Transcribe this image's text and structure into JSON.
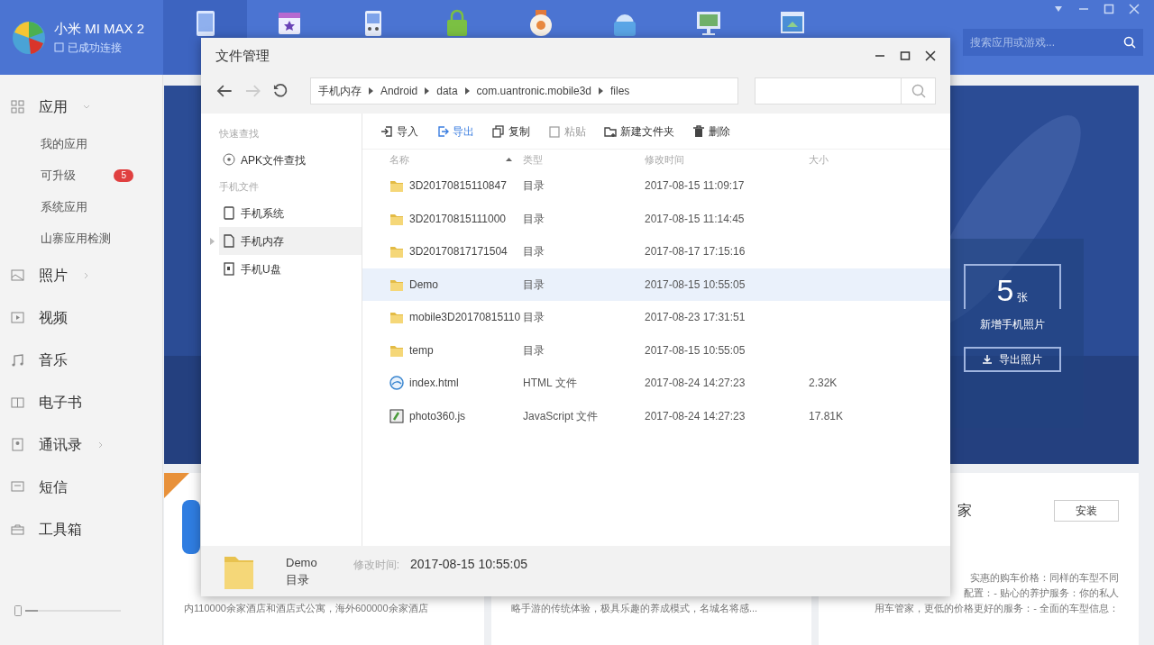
{
  "app": {
    "device_name": "小米 MI MAX 2",
    "connection_status": "已成功连接",
    "search_placeholder": "搜索应用或游戏..."
  },
  "top_nav": [
    {
      "kind": "tablet",
      "selected": true
    },
    {
      "kind": "calendar",
      "selected": false
    },
    {
      "kind": "gamepad",
      "selected": false
    },
    {
      "kind": "bag",
      "selected": false
    },
    {
      "kind": "medal",
      "selected": false
    },
    {
      "kind": "basket",
      "selected": false
    },
    {
      "kind": "monitor",
      "selected": false
    },
    {
      "kind": "window",
      "selected": false
    }
  ],
  "sidebar": {
    "items": [
      {
        "label": "应用",
        "kind": "apps",
        "expanded": true,
        "children": [
          {
            "label": "我的应用"
          },
          {
            "label": "可升级",
            "badge": "5"
          },
          {
            "label": "系统应用"
          },
          {
            "label": "山寨应用检测"
          }
        ]
      },
      {
        "label": "照片",
        "expanded": false
      },
      {
        "label": "视频",
        "kind": "video"
      },
      {
        "label": "音乐",
        "kind": "music"
      },
      {
        "label": "电子书",
        "kind": "book"
      },
      {
        "label": "通讯录",
        "kind": "contacts",
        "expanded": false
      },
      {
        "label": "短信",
        "kind": "sms"
      },
      {
        "label": "工具箱",
        "kind": "toolbox"
      }
    ]
  },
  "photo_panel": {
    "count": "5",
    "unit": "张",
    "label": "新增手机照片",
    "button": "导出照片"
  },
  "cards": [
    {
      "lines": [
        "内110000余家酒店和酒店式公寓，海外600000余家酒店"
      ]
    },
    {
      "lines": [
        "略手游的传统体验，极具乐趣的养成模式，名城名将感..."
      ]
    },
    {
      "title": "家",
      "button": "安装",
      "lines": [
        "实惠的购车价格：同样的车型不同",
        "配置：- 贴心的养护服务：你的私人",
        "用车管家，更低的价格更好的服务：- 全面的车型信息："
      ]
    }
  ],
  "dialog": {
    "title": "文件管理",
    "breadcrumb": [
      "手机内存",
      "Android",
      "data",
      "com.uantronic.mobile3d",
      "files"
    ],
    "sections": [
      {
        "heading": "快速查找",
        "items": [
          {
            "kind": "target",
            "label": "APK文件查找",
            "selected": false
          }
        ]
      },
      {
        "heading": "手机文件",
        "items": [
          {
            "kind": "phone",
            "label": "手机系统",
            "selected": false
          },
          {
            "kind": "card",
            "label": "手机内存",
            "selected": true
          },
          {
            "kind": "usb",
            "label": "手机U盘",
            "selected": false
          }
        ]
      }
    ],
    "toolbar": [
      {
        "kind": "import",
        "label": "导入",
        "highlighted": false,
        "disabled": false
      },
      {
        "kind": "export",
        "label": "导出",
        "highlighted": true,
        "disabled": false
      },
      {
        "kind": "copy",
        "label": "复制",
        "highlighted": false,
        "disabled": false
      },
      {
        "kind": "paste",
        "label": "粘贴",
        "highlighted": false,
        "disabled": true
      },
      {
        "kind": "newfolder",
        "label": "新建文件夹",
        "highlighted": false,
        "disabled": false
      },
      {
        "kind": "delete",
        "label": "删除",
        "highlighted": false,
        "disabled": false
      }
    ],
    "columns": [
      {
        "label": "名称",
        "sorted": true
      },
      {
        "label": "类型",
        "sorted": false
      },
      {
        "label": "修改时间",
        "sorted": false
      },
      {
        "label": "大小",
        "sorted": false
      }
    ],
    "rows": [
      {
        "kind": "folder",
        "name": "3D20170815110847",
        "type": "目录",
        "modified": "2017-08-15 11:09:17",
        "selected": false
      },
      {
        "kind": "folder",
        "name": "3D20170815111000",
        "type": "目录",
        "modified": "2017-08-15 11:14:45",
        "selected": false
      },
      {
        "kind": "folder",
        "name": "3D20170817171504",
        "type": "目录",
        "modified": "2017-08-17 17:15:16",
        "selected": false
      },
      {
        "kind": "folder",
        "name": "Demo",
        "type": "目录",
        "modified": "2017-08-15 10:55:05",
        "selected": true
      },
      {
        "kind": "folder",
        "name": "mobile3D20170815110",
        "type": "目录",
        "modified": "2017-08-23 17:31:51",
        "selected": false
      },
      {
        "kind": "folder",
        "name": "temp",
        "type": "目录",
        "modified": "2017-08-15 10:55:05",
        "selected": false
      },
      {
        "kind": "html",
        "name": "index.html",
        "type": "HTML 文件",
        "modified": "2017-08-24 14:27:23",
        "size": "2.32K",
        "selected": false
      },
      {
        "kind": "script",
        "name": "photo360.js",
        "type": "JavaScript 文件",
        "modified": "2017-08-24 14:27:23",
        "size": "17.81K",
        "selected": false
      }
    ],
    "footer": {
      "name": "Demo",
      "type": "目录",
      "modified_label": "修改时间:",
      "modified": "2017-08-15 10:55:05"
    }
  }
}
